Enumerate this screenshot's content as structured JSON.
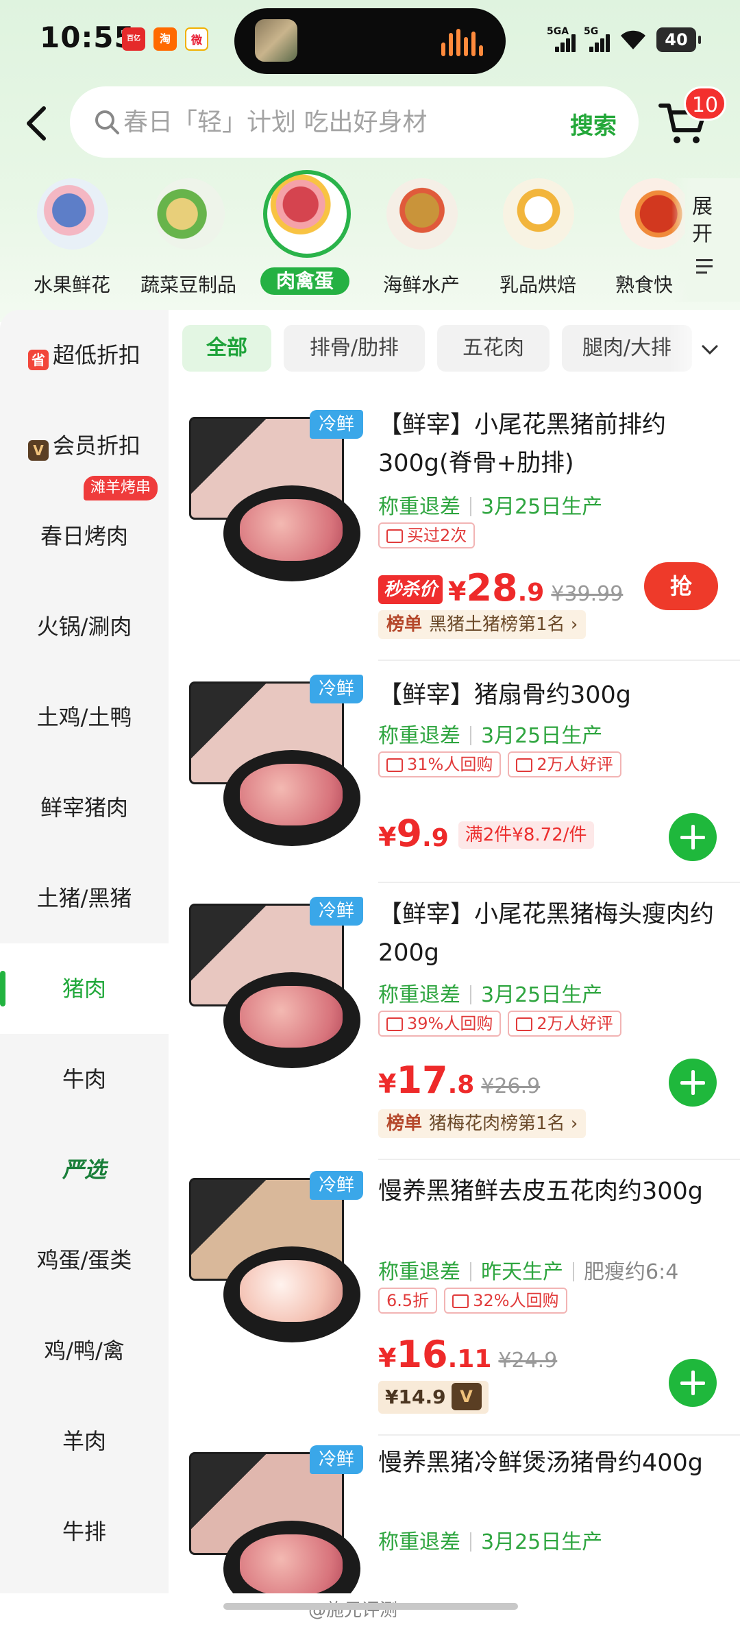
{
  "status_bar": {
    "time": "10:55",
    "signal1": "5GA",
    "signal2": "5G",
    "battery": "40"
  },
  "header": {
    "search_placeholder": "春日「轻」计划 吃出好身材",
    "search_button": "搜索",
    "cart_badge": "10",
    "back_icon": "chevron-left-icon",
    "cart_icon": "cart-icon"
  },
  "categories": [
    {
      "label": "水果鲜花",
      "selected": false
    },
    {
      "label": "蔬菜豆制品",
      "selected": false
    },
    {
      "label": "肉禽蛋",
      "selected": true
    },
    {
      "label": "海鲜水产",
      "selected": false
    },
    {
      "label": "乳品烘焙",
      "selected": false
    },
    {
      "label": "熟食快",
      "selected": false
    }
  ],
  "expand_label": "展开",
  "sidebar": {
    "items": [
      {
        "label": "超低折扣",
        "icon": "省"
      },
      {
        "label": "会员折扣",
        "icon": "V"
      },
      {
        "label": "春日烤肉"
      },
      {
        "label": "火锅/涮肉"
      },
      {
        "label": "土鸡/土鸭"
      },
      {
        "label": "鲜宰猪肉"
      },
      {
        "label": "土猪/黑猪"
      },
      {
        "label": "猪肉",
        "active": true
      },
      {
        "label": "牛肉"
      },
      {
        "label": "严选"
      },
      {
        "label": "鸡蛋/蛋类"
      },
      {
        "label": "鸡/鸭/禽"
      },
      {
        "label": "羊肉"
      },
      {
        "label": "牛排"
      }
    ],
    "promo_tag": "滩羊烤串"
  },
  "filters": {
    "chips": [
      "全部",
      "排骨/肋排",
      "五花肉",
      "腿肉/大排"
    ]
  },
  "products": [
    {
      "title": "【鲜宰】小尾花黑猪前排约300g(脊骨+肋排)",
      "badge": "冷鲜",
      "meta1": "称重退差",
      "meta2": "3月25日生产",
      "tags": [
        "买过2次"
      ],
      "seckill": "秒杀价",
      "price_int": "28",
      "price_dec": ".9",
      "old_price": "¥39.99",
      "rank_tag": "榜单",
      "rank_text": "黑猪土猪榜第1名",
      "action": "抢"
    },
    {
      "title": "【鲜宰】猪扇骨约300g",
      "badge": "冷鲜",
      "meta1": "称重退差",
      "meta2": "3月25日生产",
      "tags": [
        "31%人回购",
        "2万人好评"
      ],
      "price_int": "9",
      "price_dec": ".9",
      "multi": "满2件¥8.72/件"
    },
    {
      "title": "【鲜宰】小尾花黑猪梅头瘦肉约200g",
      "badge": "冷鲜",
      "meta1": "称重退差",
      "meta2": "3月25日生产",
      "tags": [
        "39%人回购",
        "2万人好评"
      ],
      "price_int": "17",
      "price_dec": ".8",
      "old_price": "¥26.9",
      "rank_tag": "榜单",
      "rank_text": "猪梅花肉榜第1名"
    },
    {
      "title": "慢养黑猪鲜去皮五花肉约300g",
      "badge": "冷鲜",
      "meta1": "称重退差",
      "meta2": "昨天生产",
      "meta3": "肥瘦约6:4",
      "tags": [
        "6.5折",
        "32%人回购"
      ],
      "price_int": "16",
      "price_dec": ".11",
      "old_price": "¥24.9",
      "vip_price": "¥14.9"
    },
    {
      "title": "慢养黑猪冷鲜煲汤猪骨约400g",
      "badge": "冷鲜",
      "meta1": "称重退差",
      "meta2": "3月25日生产"
    }
  ],
  "currency": "¥",
  "watermark": "@施兄评测",
  "colors": {
    "accent": "#24a83a",
    "price": "#ee2a2a",
    "badge_blue": "#3aa7e9"
  }
}
